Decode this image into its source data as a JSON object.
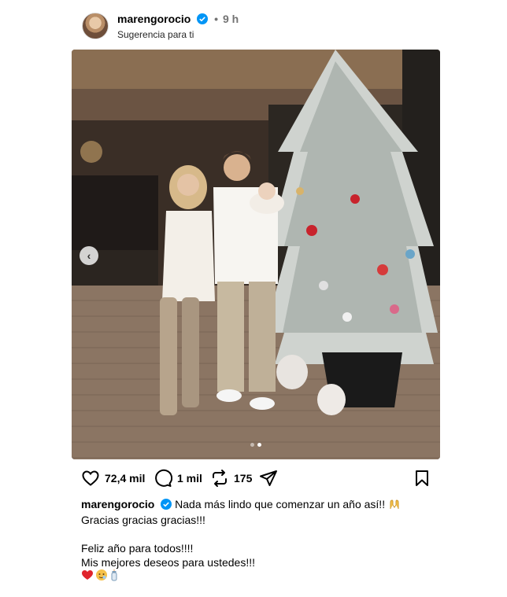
{
  "post": {
    "username": "marengorocio",
    "time": "9 h",
    "subtitle": "Sugerencia para ti",
    "likes": "72,4 mil",
    "comments": "1 mil",
    "reposts": "175"
  },
  "caption": {
    "username": "marengorocio",
    "line1": "Nada más lindo que comenzar un año así!!",
    "line2": "Gracias gracias gracias!!!",
    "line3": "Feliz año para todos!!!!",
    "line4": "Mis mejores deseos para ustedes!!!"
  },
  "carousel": {
    "count": 2,
    "active": 2
  },
  "icons": {
    "verified": "verified-badge-icon",
    "like": "heart-icon",
    "comment": "comment-bubble-icon",
    "repost": "repost-icon",
    "share": "send-icon",
    "save": "bookmark-icon",
    "prev": "chevron-left-icon"
  },
  "colors": {
    "verified": "#0095f6",
    "muted": "#737373"
  }
}
